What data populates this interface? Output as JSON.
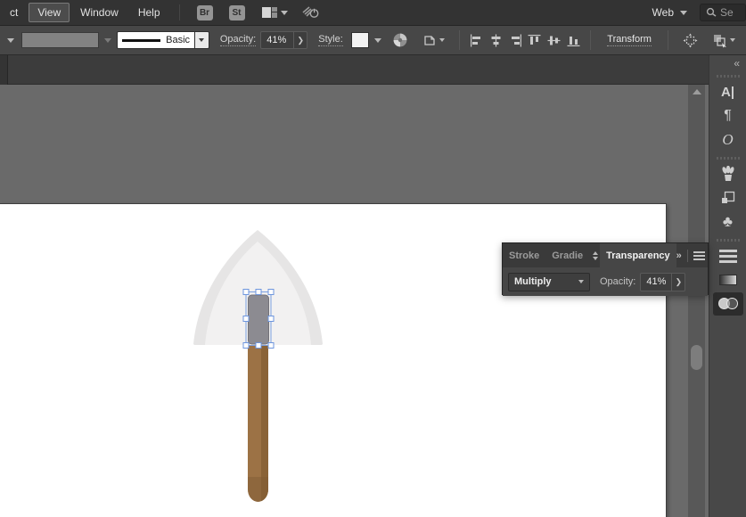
{
  "menu_bar": {
    "items": [
      {
        "label": "ct",
        "active": false
      },
      {
        "label": "View",
        "active": true
      },
      {
        "label": "Window",
        "active": false
      },
      {
        "label": "Help",
        "active": false
      }
    ],
    "bridge_label": "Br",
    "stock_label": "St",
    "workspace_label": "Web",
    "search_text": "Se"
  },
  "options_bar": {
    "brush_definition": "Basic",
    "opacity_label": "Opacity:",
    "opacity_value": "41%",
    "style_label": "Style:",
    "transform_label": "Transform"
  },
  "transparency_panel": {
    "tabs": [
      {
        "label": "Stroke",
        "active": false
      },
      {
        "label": "Gradie",
        "active": false
      },
      {
        "label": "Transparency",
        "active": true
      }
    ],
    "blend_mode": "Multiply",
    "opacity_label": "Opacity:",
    "opacity_value": "41%",
    "overflow_glyph": "»"
  },
  "dock": {
    "collapse_glyph": "«",
    "character_glyph": "A|",
    "paragraph_glyph": "¶",
    "opentype_glyph": "O",
    "symbols_glyph": "♣",
    "icons": [
      "character",
      "paragraph",
      "opentype",
      "brushes",
      "transform",
      "symbols",
      "stroke",
      "gradient",
      "transparency"
    ],
    "selected_icon": "transparency"
  },
  "canvas": {
    "object": "shovel-illustration",
    "selected_part": "socket",
    "colors": {
      "pasteboard": "#6a6a6a",
      "artboard": "#ffffff",
      "blade_outer": "#e6e5e5",
      "blade_inner": "#f2f1f1",
      "socket": "#8c8b91",
      "handle": "#9c7245",
      "handle_shadow": "#8a6337",
      "selection_blue": "#7ba0e0"
    }
  }
}
